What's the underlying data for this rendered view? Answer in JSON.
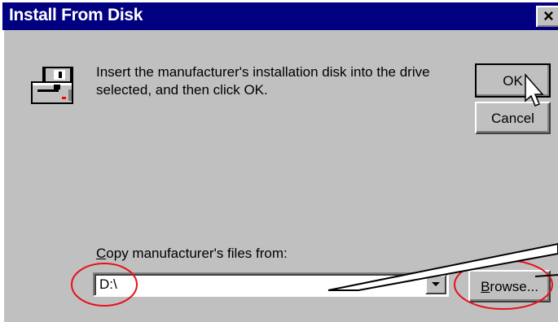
{
  "window": {
    "title": "Install From Disk",
    "close_glyph": "×"
  },
  "message": {
    "line1": "Insert the manufacturer's installation disk into the drive",
    "line2": "selected, and then click OK."
  },
  "buttons": {
    "ok": "OK",
    "cancel": "Cancel",
    "browse": "Browse..."
  },
  "copy": {
    "label_accel": "C",
    "label_rest": "opy manufacturer's files from:",
    "value": "D:\\"
  },
  "colors": {
    "title_bar": "#000080",
    "face": "#c0c0c0",
    "annotation": "#e8101a"
  },
  "icons": {
    "disk": "floppy-drive-icon",
    "cursor": "mouse-pointer-icon"
  }
}
